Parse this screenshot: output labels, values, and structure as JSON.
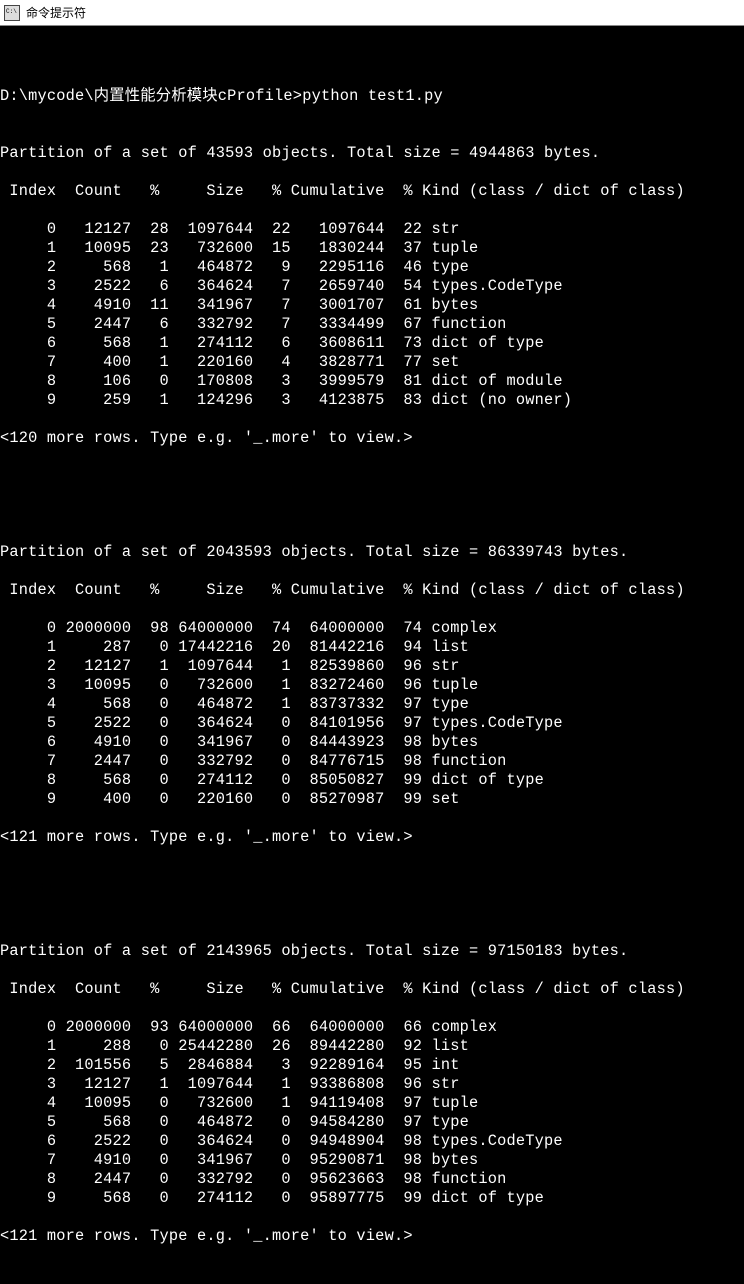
{
  "window": {
    "title": "命令提示符"
  },
  "prompt": {
    "path": "D:\\mycode\\内置性能分析模块cProfile>",
    "command": "python test1.py"
  },
  "partitions": [
    {
      "header": "Partition of a set of 43593 objects. Total size = 4944863 bytes.",
      "columns": " Index  Count   %     Size   % Cumulative  % Kind (class / dict of class)",
      "rows": [
        {
          "index": 0,
          "count": 12127,
          "countPct": 28,
          "size": 1097644,
          "sizePct": 22,
          "cumulative": 1097644,
          "cumPct": 22,
          "kind": "str"
        },
        {
          "index": 1,
          "count": 10095,
          "countPct": 23,
          "size": 732600,
          "sizePct": 15,
          "cumulative": 1830244,
          "cumPct": 37,
          "kind": "tuple"
        },
        {
          "index": 2,
          "count": 568,
          "countPct": 1,
          "size": 464872,
          "sizePct": 9,
          "cumulative": 2295116,
          "cumPct": 46,
          "kind": "type"
        },
        {
          "index": 3,
          "count": 2522,
          "countPct": 6,
          "size": 364624,
          "sizePct": 7,
          "cumulative": 2659740,
          "cumPct": 54,
          "kind": "types.CodeType"
        },
        {
          "index": 4,
          "count": 4910,
          "countPct": 11,
          "size": 341967,
          "sizePct": 7,
          "cumulative": 3001707,
          "cumPct": 61,
          "kind": "bytes"
        },
        {
          "index": 5,
          "count": 2447,
          "countPct": 6,
          "size": 332792,
          "sizePct": 7,
          "cumulative": 3334499,
          "cumPct": 67,
          "kind": "function"
        },
        {
          "index": 6,
          "count": 568,
          "countPct": 1,
          "size": 274112,
          "sizePct": 6,
          "cumulative": 3608611,
          "cumPct": 73,
          "kind": "dict of type"
        },
        {
          "index": 7,
          "count": 400,
          "countPct": 1,
          "size": 220160,
          "sizePct": 4,
          "cumulative": 3828771,
          "cumPct": 77,
          "kind": "set"
        },
        {
          "index": 8,
          "count": 106,
          "countPct": 0,
          "size": 170808,
          "sizePct": 3,
          "cumulative": 3999579,
          "cumPct": 81,
          "kind": "dict of module"
        },
        {
          "index": 9,
          "count": 259,
          "countPct": 1,
          "size": 124296,
          "sizePct": 3,
          "cumulative": 4123875,
          "cumPct": 83,
          "kind": "dict (no owner)"
        }
      ],
      "footer": "<120 more rows. Type e.g. '_.more' to view.>"
    },
    {
      "header": "Partition of a set of 2043593 objects. Total size = 86339743 bytes.",
      "columns": " Index  Count   %     Size   % Cumulative  % Kind (class / dict of class)",
      "rows": [
        {
          "index": 0,
          "count": 2000000,
          "countPct": 98,
          "size": 64000000,
          "sizePct": 74,
          "cumulative": 64000000,
          "cumPct": 74,
          "kind": "complex"
        },
        {
          "index": 1,
          "count": 287,
          "countPct": 0,
          "size": 17442216,
          "sizePct": 20,
          "cumulative": 81442216,
          "cumPct": 94,
          "kind": "list"
        },
        {
          "index": 2,
          "count": 12127,
          "countPct": 1,
          "size": 1097644,
          "sizePct": 1,
          "cumulative": 82539860,
          "cumPct": 96,
          "kind": "str"
        },
        {
          "index": 3,
          "count": 10095,
          "countPct": 0,
          "size": 732600,
          "sizePct": 1,
          "cumulative": 83272460,
          "cumPct": 96,
          "kind": "tuple"
        },
        {
          "index": 4,
          "count": 568,
          "countPct": 0,
          "size": 464872,
          "sizePct": 1,
          "cumulative": 83737332,
          "cumPct": 97,
          "kind": "type"
        },
        {
          "index": 5,
          "count": 2522,
          "countPct": 0,
          "size": 364624,
          "sizePct": 0,
          "cumulative": 84101956,
          "cumPct": 97,
          "kind": "types.CodeType"
        },
        {
          "index": 6,
          "count": 4910,
          "countPct": 0,
          "size": 341967,
          "sizePct": 0,
          "cumulative": 84443923,
          "cumPct": 98,
          "kind": "bytes"
        },
        {
          "index": 7,
          "count": 2447,
          "countPct": 0,
          "size": 332792,
          "sizePct": 0,
          "cumulative": 84776715,
          "cumPct": 98,
          "kind": "function"
        },
        {
          "index": 8,
          "count": 568,
          "countPct": 0,
          "size": 274112,
          "sizePct": 0,
          "cumulative": 85050827,
          "cumPct": 99,
          "kind": "dict of type"
        },
        {
          "index": 9,
          "count": 400,
          "countPct": 0,
          "size": 220160,
          "sizePct": 0,
          "cumulative": 85270987,
          "cumPct": 99,
          "kind": "set"
        }
      ],
      "footer": "<121 more rows. Type e.g. '_.more' to view.>"
    },
    {
      "header": "Partition of a set of 2143965 objects. Total size = 97150183 bytes.",
      "columns": " Index  Count   %     Size   % Cumulative  % Kind (class / dict of class)",
      "rows": [
        {
          "index": 0,
          "count": 2000000,
          "countPct": 93,
          "size": 64000000,
          "sizePct": 66,
          "cumulative": 64000000,
          "cumPct": 66,
          "kind": "complex"
        },
        {
          "index": 1,
          "count": 288,
          "countPct": 0,
          "size": 25442280,
          "sizePct": 26,
          "cumulative": 89442280,
          "cumPct": 92,
          "kind": "list"
        },
        {
          "index": 2,
          "count": 101556,
          "countPct": 5,
          "size": 2846884,
          "sizePct": 3,
          "cumulative": 92289164,
          "cumPct": 95,
          "kind": "int"
        },
        {
          "index": 3,
          "count": 12127,
          "countPct": 1,
          "size": 1097644,
          "sizePct": 1,
          "cumulative": 93386808,
          "cumPct": 96,
          "kind": "str"
        },
        {
          "index": 4,
          "count": 10095,
          "countPct": 0,
          "size": 732600,
          "sizePct": 1,
          "cumulative": 94119408,
          "cumPct": 97,
          "kind": "tuple"
        },
        {
          "index": 5,
          "count": 568,
          "countPct": 0,
          "size": 464872,
          "sizePct": 0,
          "cumulative": 94584280,
          "cumPct": 97,
          "kind": "type"
        },
        {
          "index": 6,
          "count": 2522,
          "countPct": 0,
          "size": 364624,
          "sizePct": 0,
          "cumulative": 94948904,
          "cumPct": 98,
          "kind": "types.CodeType"
        },
        {
          "index": 7,
          "count": 4910,
          "countPct": 0,
          "size": 341967,
          "sizePct": 0,
          "cumulative": 95290871,
          "cumPct": 98,
          "kind": "bytes"
        },
        {
          "index": 8,
          "count": 2447,
          "countPct": 0,
          "size": 332792,
          "sizePct": 0,
          "cumulative": 95623663,
          "cumPct": 98,
          "kind": "function"
        },
        {
          "index": 9,
          "count": 568,
          "countPct": 0,
          "size": 274112,
          "sizePct": 0,
          "cumulative": 95897775,
          "cumPct": 99,
          "kind": "dict of type"
        }
      ],
      "footer": "<121 more rows. Type e.g. '_.more' to view.>"
    }
  ]
}
